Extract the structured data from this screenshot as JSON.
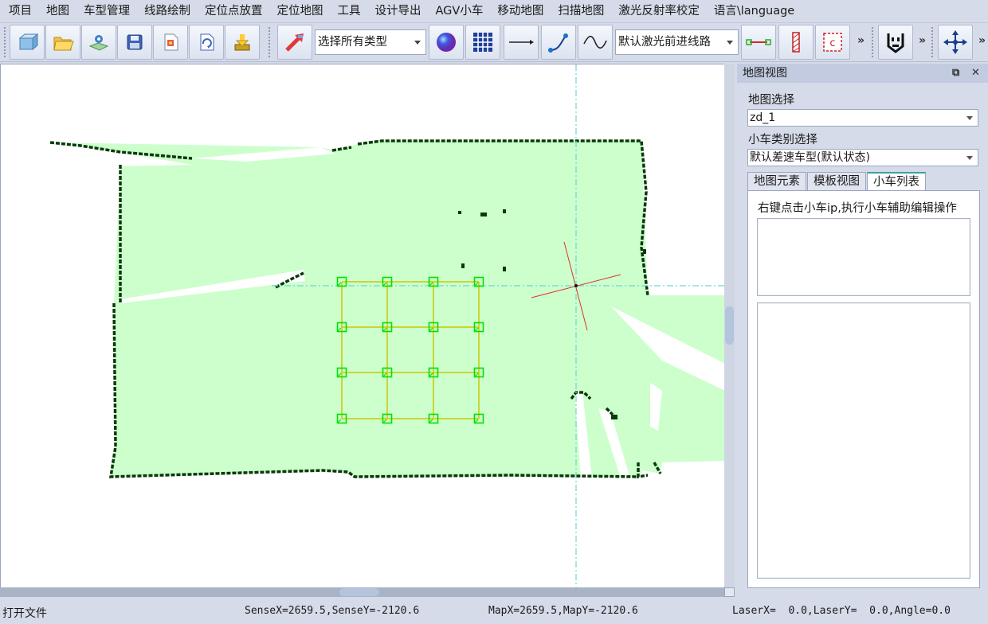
{
  "menu": [
    "项目",
    "地图",
    "车型管理",
    "线路绘制",
    "定位点放置",
    "定位地图",
    "工具",
    "设计导出",
    "AGV小车",
    "移动地图",
    "扫描地图",
    "激光反射率校定",
    "语言\\language"
  ],
  "toolbar": {
    "type_filter": "选择所有类型",
    "line_type": "默认激光前进线路",
    "overflow": "»"
  },
  "panel": {
    "title": "地图视图",
    "map_select_label": "地图选择",
    "map_select_value": "zd_1",
    "vehicle_type_label": "小车类别选择",
    "vehicle_type_value": "默认差速车型(默认状态)",
    "tabs": [
      "地图元素",
      "模板视图",
      "小车列表"
    ],
    "active_tab": 2,
    "hint": "右键点击小车ip,执行小车辅助编辑操作"
  },
  "status": {
    "left": "打开文件",
    "sense": "SenseX=2659.5,SenseY=-2120.6",
    "map": "MapX=2659.5,MapY=-2120.6",
    "laser": "LaserX=  0.0,LaserY=  0.0,Angle=0.0"
  },
  "colors": {
    "map_floor": "#ccffcc",
    "map_wall": "#0a3a0a",
    "grid_line": "#c8c800",
    "grid_node": "#00e000",
    "crosshair": "#6fd5d5",
    "robot": "#e03030"
  }
}
